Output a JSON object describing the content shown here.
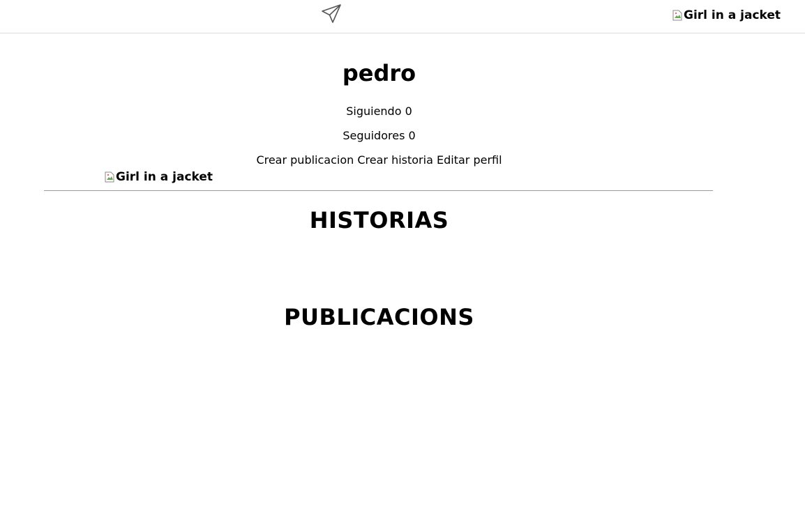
{
  "header": {
    "send_icon": "paper-plane-icon",
    "avatar_alt": "Girl in a jacket",
    "avatar_icon": "broken-image-icon"
  },
  "profile": {
    "username": "pedro",
    "following_label": "Siguiendo",
    "following_count": "0",
    "followers_label": "Seguidores",
    "followers_count": "0",
    "picture_alt": "Girl in a jacket"
  },
  "actions": {
    "create_post": "Crear publicacion",
    "create_story": "Crear historia",
    "edit_profile": "Editar perfil"
  },
  "sections": {
    "stories_title": "HISTORIAS",
    "posts_title": "PUBLICACIONS"
  },
  "colors": {
    "divider": "#9a9a9a",
    "header_border": "#dcdcdc"
  }
}
